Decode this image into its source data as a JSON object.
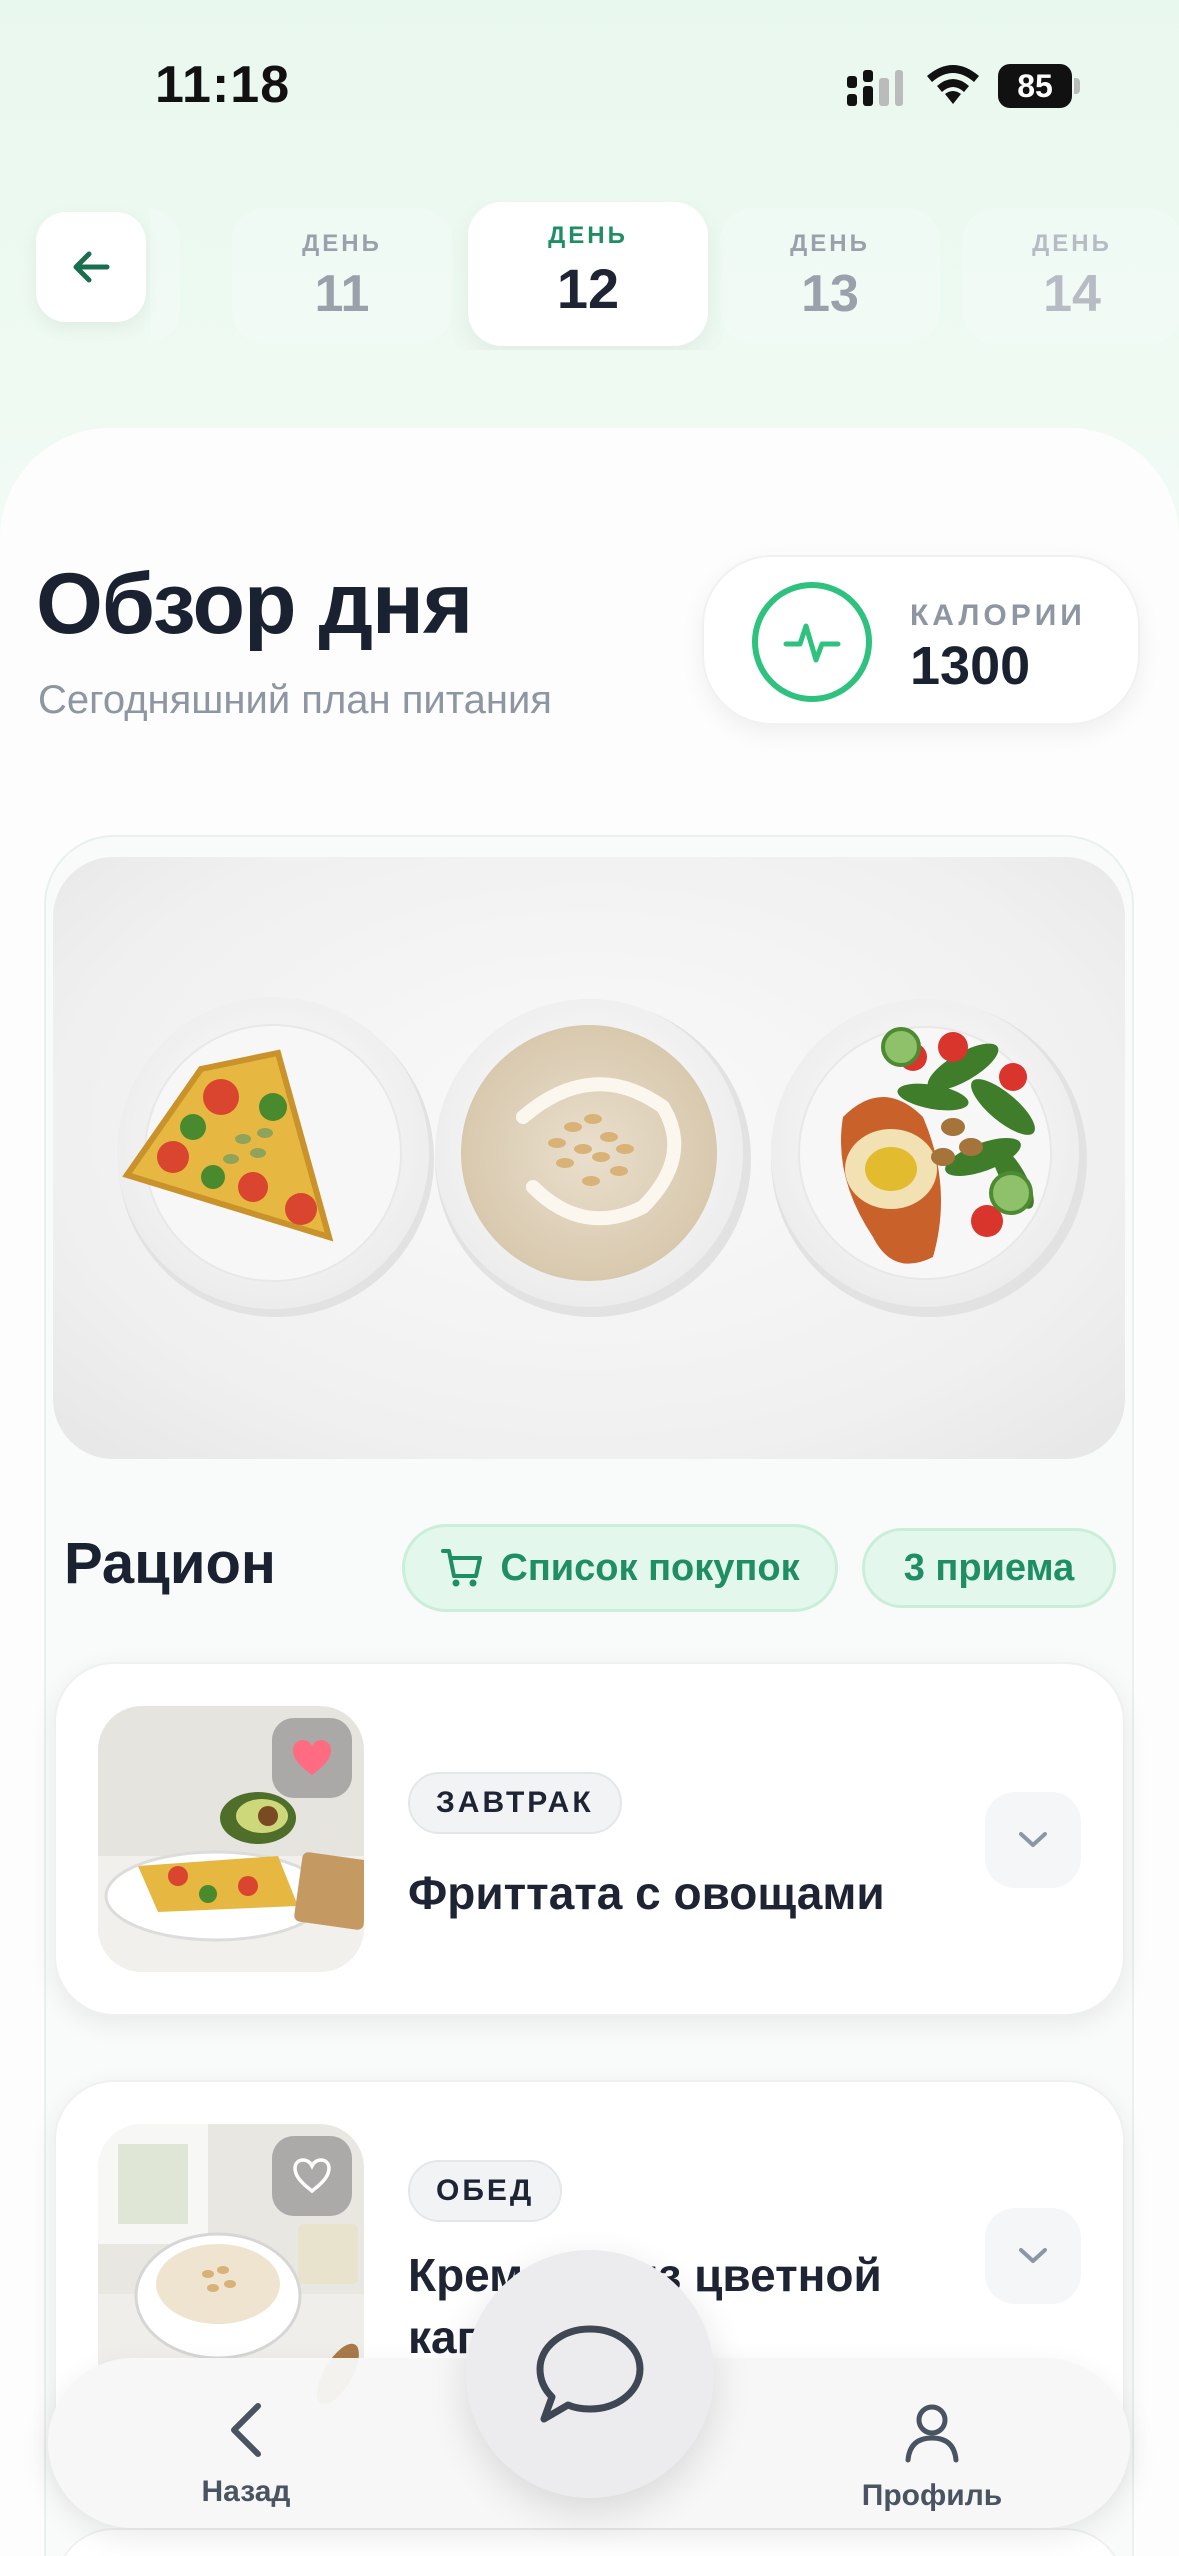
{
  "status_bar": {
    "time": "11:18",
    "battery": "85"
  },
  "day_selector": {
    "days": [
      {
        "label": "ДЕНЬ",
        "number": "11"
      },
      {
        "label": "ДЕНЬ",
        "number": "12"
      },
      {
        "label": "ДЕНЬ",
        "number": "13"
      },
      {
        "label": "ДЕНЬ",
        "number": "14"
      }
    ],
    "active_day": "12"
  },
  "overview": {
    "title": "Обзор дня",
    "subtitle": "Сегодняшний план питания",
    "calories_label": "КАЛОРИИ",
    "calories_value": "1300"
  },
  "ration": {
    "title": "Рацион",
    "shopping_list_label": "Список покупок",
    "meals_count_label": "3 приема"
  },
  "meals": [
    {
      "tag": "ЗАВТРАК",
      "name": "Фриттата с овощами",
      "favorite": true
    },
    {
      "tag": "ОБЕД",
      "name": "Крем-суп из цветной капусты",
      "favorite": false
    }
  ],
  "bottom_nav": {
    "back_label": "Назад",
    "profile_label": "Профиль"
  },
  "colors": {
    "accent": "#1f8f63",
    "accent_light": "#e3f7ec",
    "calorie_ring": "#2fc27f",
    "favorite": "#ff6b81"
  }
}
